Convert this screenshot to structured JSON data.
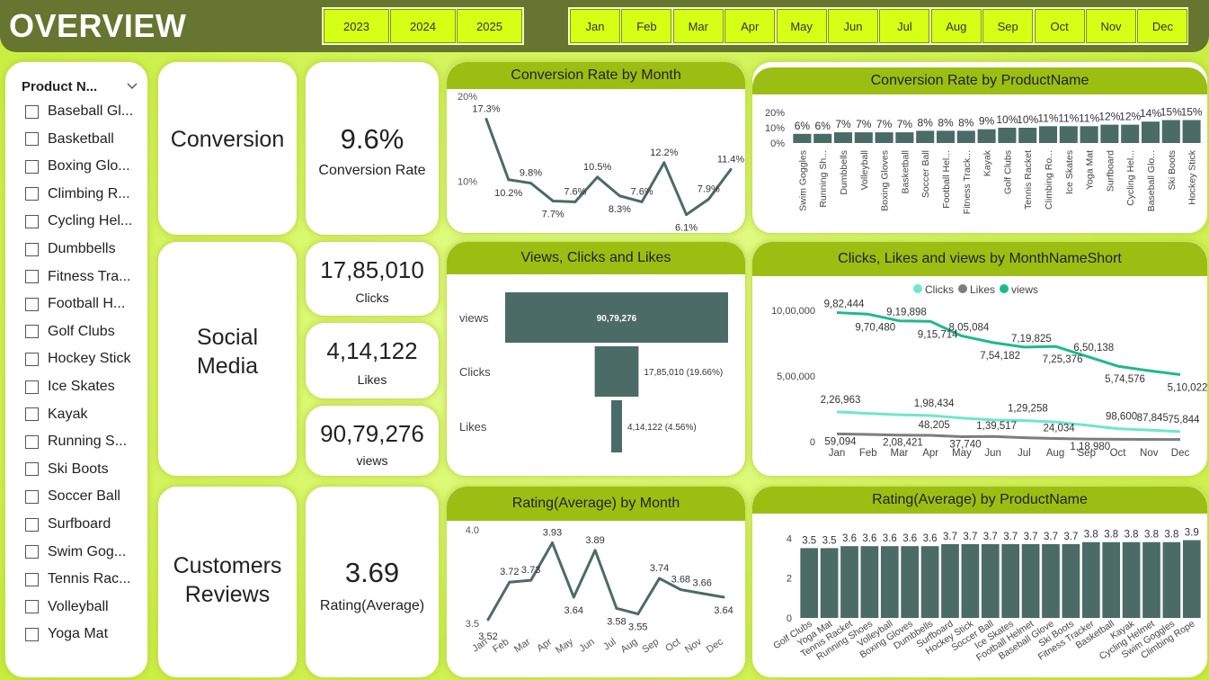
{
  "header": {
    "title": "OVERVIEW"
  },
  "years": [
    "2023",
    "2024",
    "2025"
  ],
  "months": [
    "Jan",
    "Feb",
    "Mar",
    "Apr",
    "May",
    "Jun",
    "Jul",
    "Aug",
    "Sep",
    "Oct",
    "Nov",
    "Dec"
  ],
  "slicer": {
    "title": "Product N...",
    "items": [
      "Baseball Gl...",
      "Basketball",
      "Boxing Glo...",
      "Climbing R...",
      "Cycling Hel...",
      "Dumbbells",
      "Fitness Tra...",
      "Football H...",
      "Golf Clubs",
      "Hockey Stick",
      "Ice Skates",
      "Kayak",
      "Running S...",
      "Ski Boots",
      "Soccer Ball",
      "Surfboard",
      "Swim Gog...",
      "Tennis Rac...",
      "Volleyball",
      "Yoga Mat"
    ]
  },
  "sections": {
    "conversion": "Conversion",
    "social": "Social\nMedia",
    "reviews": "Customers\nReviews"
  },
  "kpis": {
    "conversion_value": "9.6%",
    "conversion_label": "Conversion Rate",
    "clicks_value": "17,85,010",
    "clicks_label": "Clicks",
    "likes_value": "4,14,122",
    "likes_label": "Likes",
    "views_value": "90,79,276",
    "views_label": "views",
    "rating_value": "3.69",
    "rating_label": "Rating(Average)"
  },
  "colors": {
    "mark": "#4b6b66",
    "header": "#66752f",
    "title_bar": "#9cbe12",
    "clicks": "#6ee6d0",
    "likes": "#7d7d7d",
    "views": "#1eb98a"
  },
  "chart_data": [
    {
      "id": "conv_month",
      "type": "line",
      "title": "Conversion Rate by Month",
      "categories": [
        "Jan",
        "Feb",
        "Mar",
        "Apr",
        "May",
        "Jun",
        "Jul",
        "Aug",
        "Sep",
        "Oct",
        "Nov",
        "Dec"
      ],
      "values": [
        17.3,
        10.2,
        9.8,
        7.7,
        7.6,
        10.5,
        8.3,
        7.6,
        12.2,
        6.1,
        7.9,
        11.4
      ],
      "labels": [
        "17.3%",
        "10.2%",
        "9.8%",
        "7.7%",
        "7.6%",
        "10.5%",
        "8.3%",
        "7.6%",
        "12.2%",
        "6.1%",
        "7.9%",
        "11.4%"
      ],
      "yticks": [
        "10%",
        "20%"
      ],
      "ylim": [
        5,
        20
      ]
    },
    {
      "id": "conv_product",
      "type": "bar",
      "title": "Conversion Rate by ProductName",
      "categories": [
        "Swim Goggles",
        "Running Sh...",
        "Dumbbells",
        "Volleyball",
        "Boxing Gloves",
        "Basketball",
        "Soccer Ball",
        "Football Hel...",
        "Fitness Track...",
        "Kayak",
        "Golf Clubs",
        "Tennis Racket",
        "Climbing Ro...",
        "Ice Skates",
        "Yoga Mat",
        "Surfboard",
        "Cycling Hel...",
        "Baseball Glo...",
        "Ski Boots",
        "Hockey Stick"
      ],
      "values": [
        6,
        6,
        7,
        7,
        7,
        7,
        8,
        8,
        8,
        9,
        10,
        10,
        11,
        11,
        11,
        12,
        12,
        14,
        15,
        15
      ],
      "labels": [
        "6%",
        "6%",
        "7%",
        "7%",
        "7%",
        "7%",
        "8%",
        "8%",
        "8%",
        "9%",
        "10%",
        "10%",
        "11%",
        "11%",
        "11%",
        "12%",
        "12%",
        "14%",
        "15%",
        "15%"
      ],
      "yticks": [
        "0%",
        "10%",
        "20%"
      ],
      "ylim": [
        0,
        20
      ]
    },
    {
      "id": "funnel",
      "type": "bar",
      "title": "Views, Clicks and Likes",
      "categories": [
        "views",
        "Clicks",
        "Likes"
      ],
      "values": [
        9079276,
        1785010,
        414122
      ],
      "labels": [
        "90,79,276",
        "17,85,010 (19.66%)",
        "4,14,122 (4.56%)"
      ]
    },
    {
      "id": "social_month",
      "type": "line",
      "title": "Clicks, Likes and views by MonthNameShort",
      "categories": [
        "Jan",
        "Feb",
        "Mar",
        "Apr",
        "May",
        "Jun",
        "Jul",
        "Aug",
        "Sep",
        "Oct",
        "Nov",
        "Dec"
      ],
      "legend": [
        "Clicks",
        "Likes",
        "views"
      ],
      "series": [
        {
          "name": "views",
          "values": [
            982444,
            970480,
            919898,
            915714,
            805084,
            754182,
            719825,
            725376,
            650138,
            574576,
            540000,
            510022
          ],
          "labels": [
            "9,82,444",
            "9,70,480",
            "9,19,898",
            "9,15,714",
            "8,05,084",
            "7,54,182",
            "7,19,825",
            "7,25,376",
            "6,50,138",
            "5,74,576",
            "",
            "5,10,022"
          ]
        },
        {
          "name": "Clicks",
          "values": [
            226963,
            215000,
            205000,
            198434,
            180000,
            165000,
            160000,
            150000,
            125000,
            98600,
            87845,
            75844
          ],
          "labels": [
            "2,26,963",
            "",
            "",
            "1,98,434",
            "",
            "",
            "1,29,258",
            "",
            "",
            "98,600",
            "87,845",
            "75,844"
          ]
        },
        {
          "name": "Likes",
          "values": [
            59094,
            55000,
            50000,
            48205,
            37740,
            39517,
            30000,
            24034,
            20000,
            18000,
            17000,
            16000
          ],
          "labels": [
            "59,094",
            "",
            "2,08,421",
            "48,205",
            "37,740",
            "1,39,517",
            "",
            "24,034",
            "1,18,980",
            "",
            "",
            ""
          ]
        }
      ],
      "yticks": [
        "0",
        "5,00,000",
        "10,00,000"
      ],
      "ylim": [
        0,
        1000000
      ]
    },
    {
      "id": "rating_month",
      "type": "line",
      "title": "Rating(Average) by Month",
      "categories": [
        "Jan",
        "Feb",
        "Mar",
        "Apr",
        "May",
        "Jun",
        "Jul",
        "Aug",
        "Sep",
        "Oct",
        "Nov",
        "Dec"
      ],
      "values": [
        3.52,
        3.72,
        3.73,
        3.93,
        3.64,
        3.89,
        3.58,
        3.55,
        3.74,
        3.68,
        3.66,
        3.64
      ],
      "labels": [
        "3.52",
        "3.72",
        "3.73",
        "3.93",
        "3.64",
        "3.89",
        "3.58",
        "3.55",
        "3.74",
        "3.68",
        "3.66",
        "3.64"
      ],
      "yticks": [
        "3.5",
        "4.0"
      ],
      "ylim": [
        3.5,
        4.0
      ]
    },
    {
      "id": "rating_product",
      "type": "bar",
      "title": "Rating(Average) by ProductName",
      "categories": [
        "Golf Clubs",
        "Yoga Mat",
        "Tennis Racket",
        "Running Shoes",
        "Volleyball",
        "Boxing Gloves",
        "Dumbbells",
        "Surfboard",
        "Hockey Stick",
        "Soccer Ball",
        "Ice Skates",
        "Football Helmet",
        "Baseball Glove",
        "Ski Boots",
        "Fitness Tracker",
        "Basketball",
        "Kayak",
        "Cycling Helmet",
        "Swim Goggles",
        "Climbing Rope"
      ],
      "values": [
        3.5,
        3.5,
        3.6,
        3.6,
        3.6,
        3.6,
        3.6,
        3.7,
        3.7,
        3.7,
        3.7,
        3.7,
        3.7,
        3.7,
        3.8,
        3.8,
        3.8,
        3.8,
        3.8,
        3.9
      ],
      "labels": [
        "3.5",
        "3.5",
        "3.6",
        "3.6",
        "3.6",
        "3.6",
        "3.6",
        "3.7",
        "3.7",
        "3.7",
        "3.7",
        "3.7",
        "3.7",
        "3.7",
        "3.8",
        "3.8",
        "3.8",
        "3.8",
        "3.8",
        "3.9"
      ],
      "yticks": [
        "0",
        "2",
        "4"
      ],
      "ylim": [
        0,
        4.6
      ]
    }
  ]
}
